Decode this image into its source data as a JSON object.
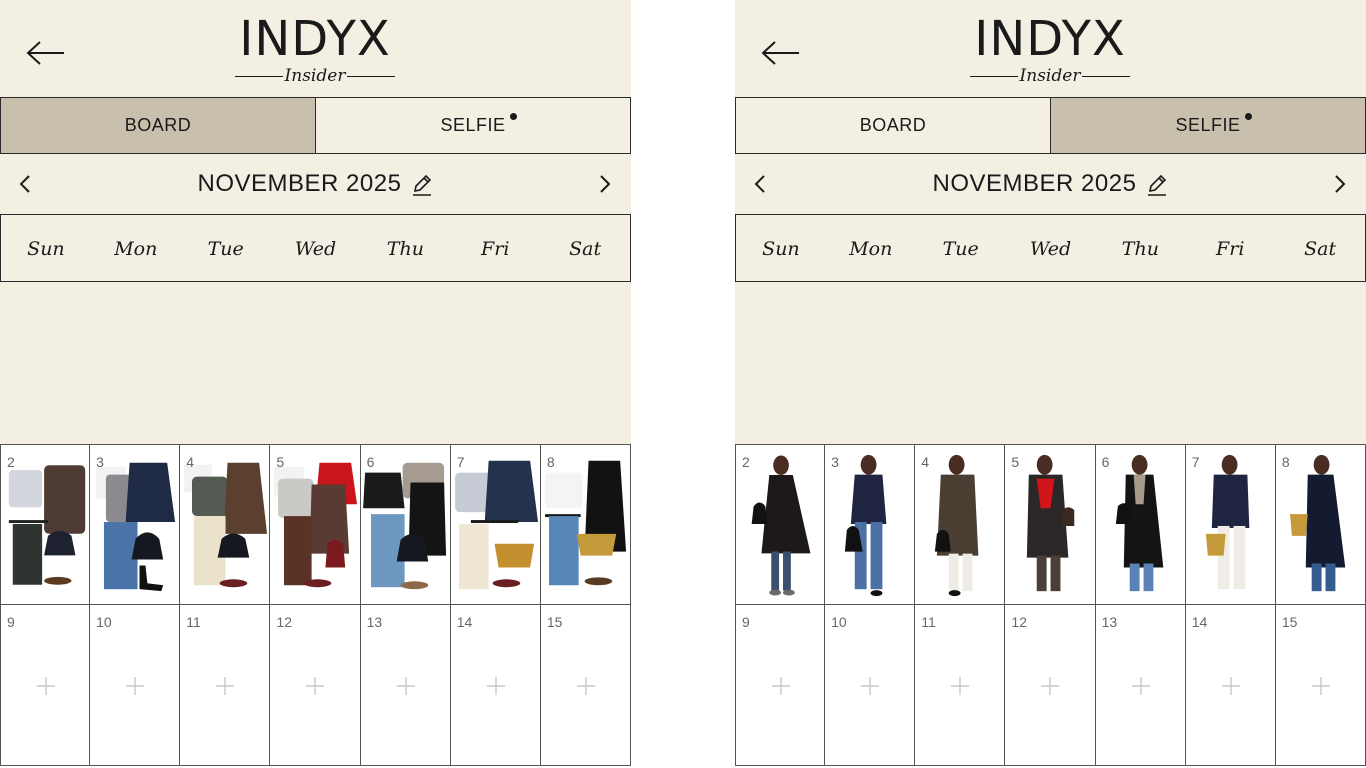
{
  "brand": {
    "name": "INDYX",
    "sub": "Insider"
  },
  "screens": [
    {
      "tabs": [
        {
          "label": "BOARD",
          "active": true
        },
        {
          "label": "SELFIE",
          "active": false,
          "dot": true
        }
      ],
      "month": "NOVEMBER 2025",
      "weekdays": [
        "Sun",
        "Mon",
        "Tue",
        "Wed",
        "Thu",
        "Fri",
        "Sat"
      ],
      "week1_days": [
        "2",
        "3",
        "4",
        "5",
        "6",
        "7",
        "8"
      ],
      "week1_content": "outfit-flatlay",
      "week2_days": [
        "9",
        "10",
        "11",
        "12",
        "13",
        "14",
        "15"
      ]
    },
    {
      "tabs": [
        {
          "label": "BOARD",
          "active": false
        },
        {
          "label": "SELFIE",
          "active": true,
          "dot": true
        }
      ],
      "month": "NOVEMBER 2025",
      "weekdays": [
        "Sun",
        "Mon",
        "Tue",
        "Wed",
        "Thu",
        "Fri",
        "Sat"
      ],
      "week1_days": [
        "2",
        "3",
        "4",
        "5",
        "6",
        "7",
        "8"
      ],
      "week1_content": "mirror-selfie",
      "week2_days": [
        "9",
        "10",
        "11",
        "12",
        "13",
        "14",
        "15"
      ]
    }
  ],
  "colors": {
    "header_bg": "#f3efe3",
    "active_tab": "#c9bfad",
    "border": "#2a2a2a",
    "plus": "#c8c8c8"
  },
  "icons": {
    "back": "arrow-left-icon",
    "prev": "chevron-left-icon",
    "next": "chevron-right-icon",
    "edit": "pencil-icon",
    "add": "plus-icon"
  }
}
